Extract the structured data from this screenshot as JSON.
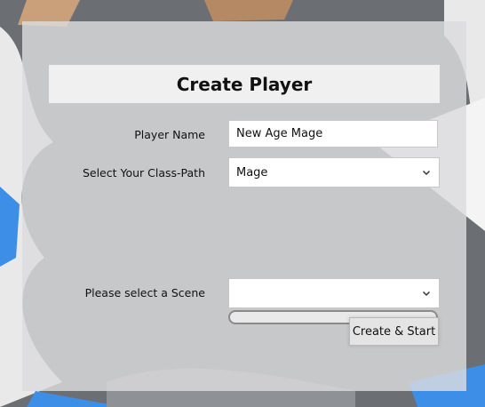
{
  "form": {
    "title": "Create Player",
    "player_name_label": "Player Name",
    "player_name_value": "New Age Mage",
    "class_path_label": "Select Your Class-Path",
    "class_path_selected": "Mage",
    "scene_label": "Please select a Scene",
    "scene_selected": "",
    "loading_progress": 0,
    "submit_label": "Create & Start"
  },
  "colors": {
    "backdrop": "#6b6e72",
    "panel": "#dcdcde",
    "title_bar": "#f0f0f0"
  },
  "icons": {
    "select_arrow": "chevron-down-icon"
  }
}
